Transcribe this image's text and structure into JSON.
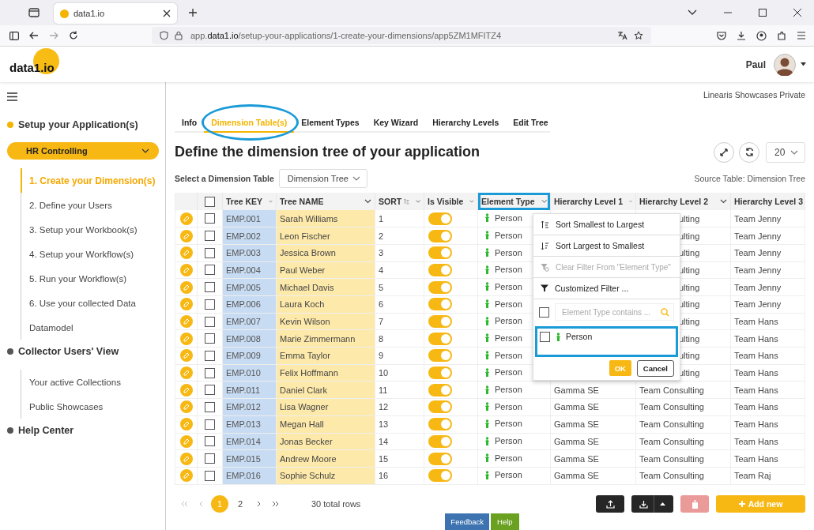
{
  "browser": {
    "tab_title": "data1.io",
    "url": "app.**data1.io**/setup-your-applications/1-create-your-dimensions/app5ZM1MFITZ4"
  },
  "header": {
    "logo": "data1.io",
    "user": "Paul"
  },
  "sidebar": {
    "sections": [
      {
        "label": "Setup your Application(s)",
        "color": "#f5b400",
        "app": "HR Controlling",
        "items": [
          {
            "label": "1. Create your Dimension(s)",
            "selected": true
          },
          {
            "label": "2. Define your Users",
            "selected": false
          },
          {
            "label": "3. Setup your Workbook(s)",
            "selected": false
          },
          {
            "label": "4. Setup your Workflow(s)",
            "selected": false
          },
          {
            "label": "5. Run your Workflow(s)",
            "selected": false
          },
          {
            "label": "6. Use your collected Data",
            "selected": false
          },
          {
            "label": "Datamodel",
            "selected": false
          }
        ]
      },
      {
        "label": "Collector Users' View",
        "color": "#555555",
        "items": [
          {
            "label": "Your active Collections",
            "selected": false
          },
          {
            "label": "Public Showcases",
            "selected": false
          }
        ]
      },
      {
        "label": "Help Center",
        "color": "#555555"
      }
    ]
  },
  "org": "Linearis Showcases Private",
  "tabs": [
    {
      "label": "Info",
      "selected": false,
      "annotated": false
    },
    {
      "label": "Dimension Table(s)",
      "selected": true,
      "annotated": true
    },
    {
      "label": "Element Types",
      "selected": false,
      "annotated": false
    },
    {
      "label": "Key Wizard",
      "selected": false,
      "annotated": false
    },
    {
      "label": "Hierarchy Levels",
      "selected": false,
      "annotated": false
    },
    {
      "label": "Edit Tree",
      "selected": false,
      "annotated": false
    }
  ],
  "title": "Define the dimension tree of your application",
  "page_size": "20",
  "table_select": {
    "label": "Select a Dimension Table",
    "value": "Dimension Tree"
  },
  "source": "Source Table: Dimension Tree",
  "table": {
    "header_checked": false,
    "columns": [
      {
        "label": "Tree KEY",
        "annotated": false
      },
      {
        "label": "Tree NAME",
        "annotated": false
      },
      {
        "label": "SORT",
        "annotated": false
      },
      {
        "label": "Is Visible",
        "annotated": false
      },
      {
        "label": "Element Type",
        "annotated": true
      },
      {
        "label": "Hierarchy Level 1",
        "annotated": false
      },
      {
        "label": "Hierarchy Level 2",
        "annotated": false
      },
      {
        "label": "Hierarchy Level 3",
        "annotated": false
      }
    ],
    "rows": [
      {
        "key": "EMP.001",
        "name": "Sarah Williams",
        "sort": "1",
        "visible": true,
        "checked": false,
        "element_type": "Person",
        "level_2": "ulting",
        "level_3": "Team Jenny"
      },
      {
        "key": "EMP.002",
        "name": "Leon Fischer",
        "sort": "2",
        "visible": true,
        "checked": false,
        "element_type": "Person",
        "level_2": "ulting",
        "level_3": "Team Jenny"
      },
      {
        "key": "EMP.003",
        "name": "Jessica Brown",
        "sort": "3",
        "visible": true,
        "checked": false,
        "element_type": "Person",
        "level_2": "ulting",
        "level_3": "Team Jenny"
      },
      {
        "key": "EMP.004",
        "name": "Paul Weber",
        "sort": "4",
        "visible": true,
        "checked": false,
        "element_type": "Person",
        "level_2": "ulting",
        "level_3": "Team Jenny"
      },
      {
        "key": "EMP.005",
        "name": "Michael Davis",
        "sort": "5",
        "visible": true,
        "checked": false,
        "element_type": "Person",
        "level_2": "ulting",
        "level_3": "Team Jenny"
      },
      {
        "key": "EMP.006",
        "name": "Laura Koch",
        "sort": "6",
        "visible": true,
        "checked": false,
        "element_type": "Person",
        "level_2": "ulting",
        "level_3": "Team Jenny"
      },
      {
        "key": "EMP.007",
        "name": "Kevin Wilson",
        "sort": "7",
        "visible": true,
        "checked": false,
        "element_type": "Person",
        "level_2": "ulting",
        "level_3": "Team Hans"
      },
      {
        "key": "EMP.008",
        "name": "Marie Zimmermann",
        "sort": "8",
        "visible": true,
        "checked": false,
        "element_type": "Person",
        "level_2": "ulting",
        "level_3": "Team Hans"
      },
      {
        "key": "EMP.009",
        "name": "Emma Taylor",
        "sort": "9",
        "visible": true,
        "checked": false,
        "element_type": "Person",
        "level_2": "ulting",
        "level_3": "Team Hans"
      },
      {
        "key": "EMP.010",
        "name": "Felix Hoffmann",
        "sort": "10",
        "visible": true,
        "checked": false,
        "element_type": "Person",
        "level_2": "ulting",
        "level_3": "Team Hans"
      },
      {
        "key": "EMP.011",
        "name": "Daniel Clark",
        "sort": "11",
        "visible": true,
        "checked": false,
        "element_type": "Person",
        "level_1": "Gamma SE",
        "level_2": "Team Consulting",
        "level_3": "Team Hans"
      },
      {
        "key": "EMP.012",
        "name": "Lisa Wagner",
        "sort": "12",
        "visible": true,
        "checked": false,
        "element_type": "Person",
        "level_1": "Gamma SE",
        "level_2": "Team Consulting",
        "level_3": "Team Hans"
      },
      {
        "key": "EMP.013",
        "name": "Megan Hall",
        "sort": "13",
        "visible": true,
        "checked": false,
        "element_type": "Person",
        "level_1": "Gamma SE",
        "level_2": "Team Consulting",
        "level_3": "Team Hans"
      },
      {
        "key": "EMP.014",
        "name": "Jonas Becker",
        "sort": "14",
        "visible": true,
        "checked": false,
        "element_type": "Person",
        "level_1": "Gamma SE",
        "level_2": "Team Consulting",
        "level_3": "Team Hans"
      },
      {
        "key": "EMP.015",
        "name": "Andrew Moore",
        "sort": "15",
        "visible": true,
        "checked": false,
        "element_type": "Person",
        "level_1": "Gamma SE",
        "level_2": "Team Consulting",
        "level_3": "Team Hans"
      },
      {
        "key": "EMP.016",
        "name": "Sophie Schulz",
        "sort": "16",
        "visible": true,
        "checked": false,
        "element_type": "Person",
        "level_1": "Gamma SE",
        "level_2": "Team Consulting",
        "level_3": "Team Raj"
      }
    ]
  },
  "filter_menu": {
    "items": [
      {
        "kind": "sort_asc",
        "label": "Sort Smallest to Largest",
        "disabled": false
      },
      {
        "kind": "sort_desc",
        "label": "Sort Largest to Smallest",
        "disabled": false
      },
      {
        "kind": "clear",
        "label": "Clear Filter From \"Element Type\"",
        "disabled": true
      },
      {
        "kind": "custom",
        "label": "Customized Filter ...",
        "disabled": false
      }
    ],
    "search": {
      "placeholder": "Element Type contains ...",
      "checked": false
    },
    "options": [
      {
        "label": "Person",
        "checked": false,
        "annotated": true
      }
    ],
    "ok": "OK",
    "cancel": "Cancel"
  },
  "pager": {
    "pages": [
      {
        "label": "1",
        "selected": true
      },
      {
        "label": "2",
        "selected": false
      }
    ],
    "total": "30 total rows"
  },
  "actions": {
    "delete_disabled": true,
    "add": "Add new"
  },
  "feedback": "Feedback",
  "help": "Help"
}
